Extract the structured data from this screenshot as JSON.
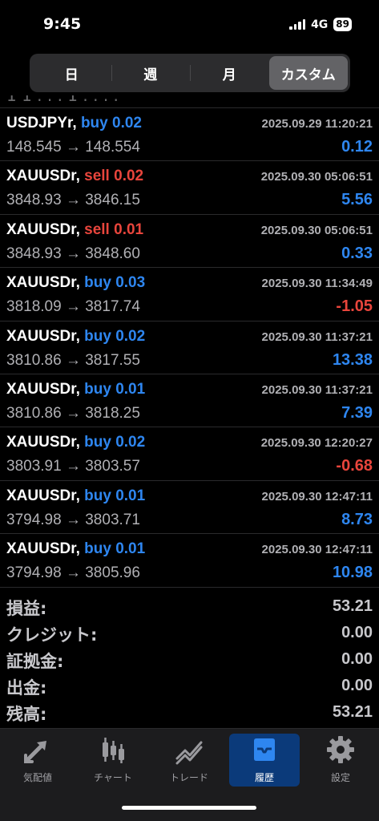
{
  "status": {
    "time": "9:45",
    "network": "4G",
    "battery": "89"
  },
  "periods": [
    {
      "label": "日",
      "active": false
    },
    {
      "label": "週",
      "active": false
    },
    {
      "label": "月",
      "active": false
    },
    {
      "label": "カスタム",
      "active": true
    }
  ],
  "trades": [
    {
      "symbol": "USDJPYr,",
      "side": "buy",
      "volume": "0.02",
      "datetime": "2025.09.29 11:20:21",
      "prices": "148.545 → 148.554",
      "profit": "0.12",
      "profit_sign": "pos"
    },
    {
      "symbol": "XAUUSDr,",
      "side": "sell",
      "volume": "0.02",
      "datetime": "2025.09.30 05:06:51",
      "prices": "3848.93 → 3846.15",
      "profit": "5.56",
      "profit_sign": "pos"
    },
    {
      "symbol": "XAUUSDr,",
      "side": "sell",
      "volume": "0.01",
      "datetime": "2025.09.30 05:06:51",
      "prices": "3848.93 → 3848.60",
      "profit": "0.33",
      "profit_sign": "pos"
    },
    {
      "symbol": "XAUUSDr,",
      "side": "buy",
      "volume": "0.03",
      "datetime": "2025.09.30 11:34:49",
      "prices": "3818.09 → 3817.74",
      "profit": "-1.05",
      "profit_sign": "neg"
    },
    {
      "symbol": "XAUUSDr,",
      "side": "buy",
      "volume": "0.02",
      "datetime": "2025.09.30 11:37:21",
      "prices": "3810.86 → 3817.55",
      "profit": "13.38",
      "profit_sign": "pos"
    },
    {
      "symbol": "XAUUSDr,",
      "side": "buy",
      "volume": "0.01",
      "datetime": "2025.09.30 11:37:21",
      "prices": "3810.86 → 3818.25",
      "profit": "7.39",
      "profit_sign": "pos"
    },
    {
      "symbol": "XAUUSDr,",
      "side": "buy",
      "volume": "0.02",
      "datetime": "2025.09.30 12:20:27",
      "prices": "3803.91 → 3803.57",
      "profit": "-0.68",
      "profit_sign": "neg"
    },
    {
      "symbol": "XAUUSDr,",
      "side": "buy",
      "volume": "0.01",
      "datetime": "2025.09.30 12:47:11",
      "prices": "3794.98 → 3803.71",
      "profit": "8.73",
      "profit_sign": "pos"
    },
    {
      "symbol": "XAUUSDr,",
      "side": "buy",
      "volume": "0.01",
      "datetime": "2025.09.30 12:47:11",
      "prices": "3794.98 → 3805.96",
      "profit": "10.98",
      "profit_sign": "pos"
    }
  ],
  "summary": [
    {
      "label": "損益:",
      "value": "53.21"
    },
    {
      "label": "クレジット:",
      "value": "0.00"
    },
    {
      "label": "証拠金:",
      "value": "0.00"
    },
    {
      "label": "出金:",
      "value": "0.00"
    },
    {
      "label": "残高:",
      "value": "53.21"
    }
  ],
  "tabs": [
    {
      "label": "気配値",
      "icon": "quotes-arrows-icon",
      "active": false
    },
    {
      "label": "チャート",
      "icon": "candlestick-chart-icon",
      "active": false
    },
    {
      "label": "トレード",
      "icon": "trade-trend-icon",
      "active": false
    },
    {
      "label": "履歴",
      "icon": "history-tray-icon",
      "active": true
    },
    {
      "label": "設定",
      "icon": "gear-icon",
      "active": false
    }
  ],
  "colors": {
    "buy": "#2e86f0",
    "sell": "#e8453c",
    "active_tab": "#0b3a7a"
  }
}
